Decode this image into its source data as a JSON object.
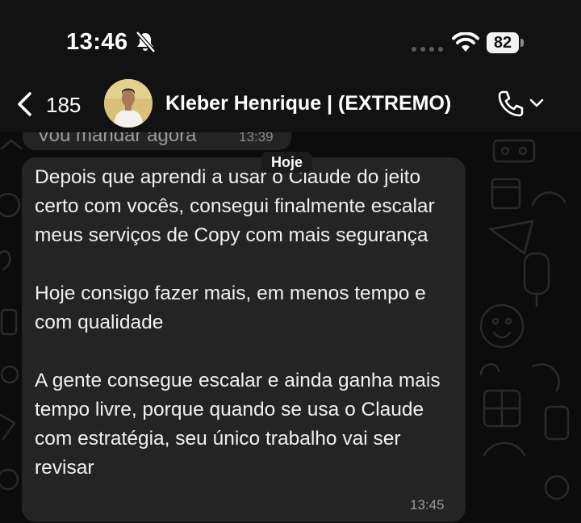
{
  "status_bar": {
    "time": "13:46",
    "battery": "82",
    "icons": [
      "bell-slash-icon",
      "signal-dots-icon",
      "wifi-icon",
      "battery-icon"
    ]
  },
  "header": {
    "back_count": "185",
    "contact_name": "Kleber Henrique | (EXTREMO)",
    "icons": [
      "chevron-left-icon",
      "phone-icon",
      "chevron-down-icon"
    ]
  },
  "chat": {
    "previous_message": {
      "text": "Vou mandar agora",
      "time": "13:39"
    },
    "date_separator": "Hoje",
    "message": {
      "paragraphs": [
        "Depois que aprendi a usar o Claude do jeito certo com vocês, consegui finalmente escalar meus serviços de Copy com mais segurança",
        "Hoje consigo fazer mais, em menos tempo e com qualidade",
        "A gente consegue escalar e ainda ganha mais tempo livre, porque quando se usa o Claude com estratégia, seu único trabalho vai ser revisar"
      ],
      "time": "13:45"
    }
  },
  "colors": {
    "background": "#0b0b0b",
    "bubble": "#242424",
    "text": "#f0f0f0",
    "timestamp": "#9a9a9a"
  }
}
